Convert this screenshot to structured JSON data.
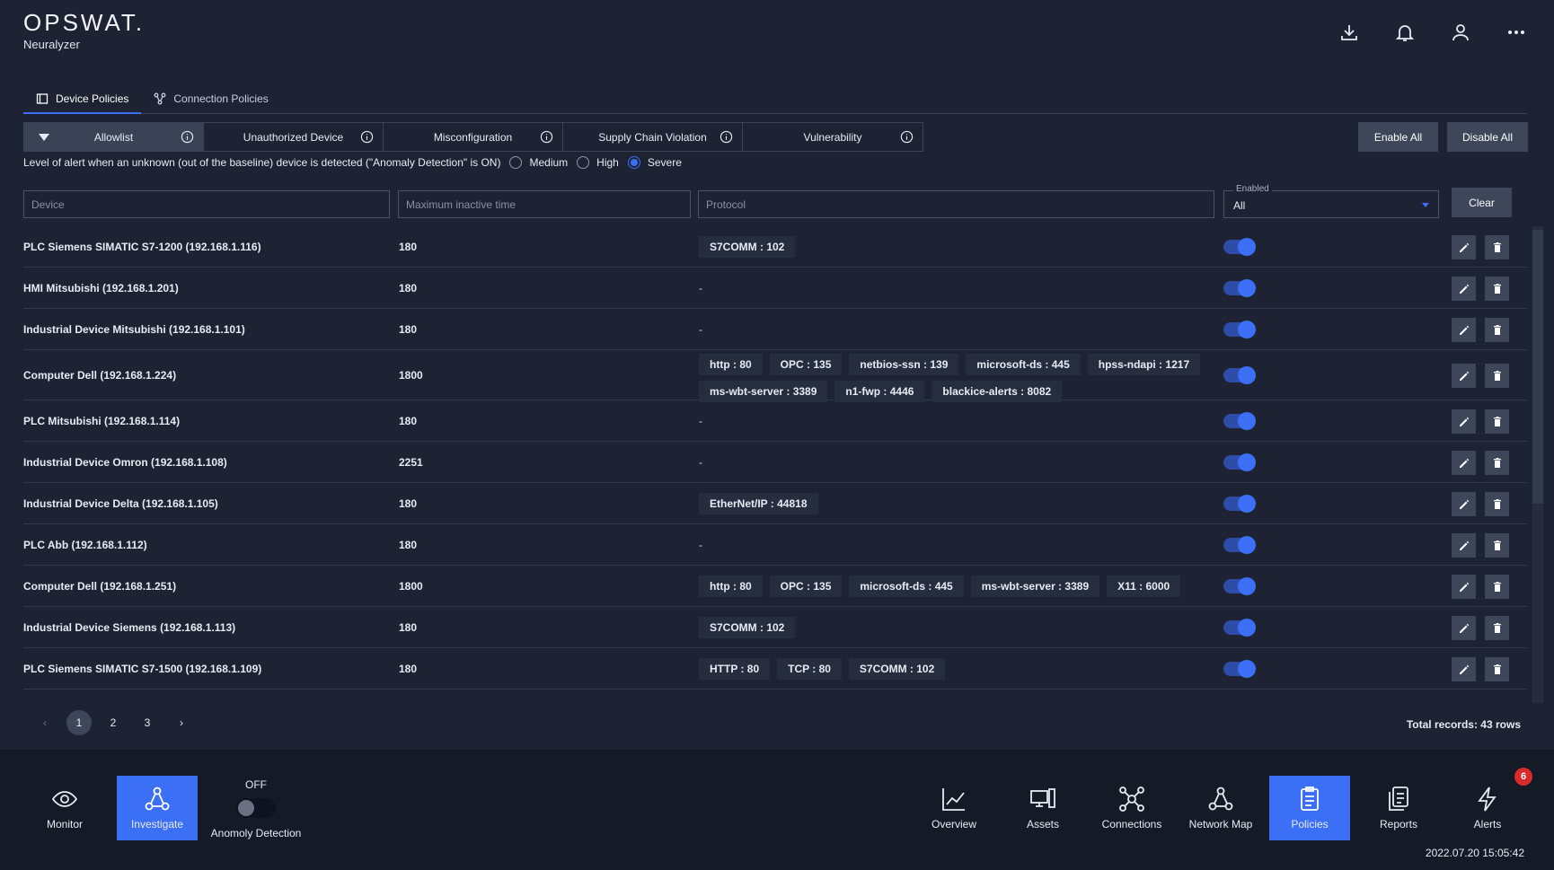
{
  "brand": {
    "logo": "OPSWAT.",
    "product": "Neuralyzer"
  },
  "top_actions": [
    "download-icon",
    "bell-icon",
    "user-icon",
    "more-icon"
  ],
  "tabs": [
    {
      "label": "Device Policies",
      "active": true
    },
    {
      "label": "Connection Policies",
      "active": false
    }
  ],
  "categories": [
    {
      "label": "Allowlist",
      "active": true
    },
    {
      "label": "Unauthorized Device"
    },
    {
      "label": "Misconfiguration"
    },
    {
      "label": "Supply Chain Violation"
    },
    {
      "label": "Vulnerability"
    }
  ],
  "buttons": {
    "enable_all": "Enable All",
    "disable_all": "Disable All",
    "clear": "Clear"
  },
  "alert_level": {
    "text": "Level of alert when an unknown (out of the baseline) device is detected (\"Anomaly Detection\" is ON)",
    "options": [
      "Medium",
      "High",
      "Severe"
    ],
    "selected": "Severe"
  },
  "filters": {
    "device_placeholder": "Device",
    "time_placeholder": "Maximum inactive time",
    "protocol_placeholder": "Protocol",
    "enabled_label": "Enabled",
    "enabled_value": "All"
  },
  "rows": [
    {
      "device": "PLC Siemens SIMATIC S7-1200 (192.168.1.116)",
      "time": "180",
      "protocols": [
        "S7COMM : 102"
      ],
      "enabled": true
    },
    {
      "device": "HMI Mitsubishi (192.168.1.201)",
      "time": "180",
      "protocols": [],
      "enabled": true
    },
    {
      "device": "Industrial Device Mitsubishi (192.168.1.101)",
      "time": "180",
      "protocols": [],
      "enabled": true
    },
    {
      "device": "Computer Dell (192.168.1.224)",
      "time": "1800",
      "protocols": [
        "http : 80",
        "OPC : 135",
        "netbios-ssn : 139",
        "microsoft-ds : 445",
        "hpss-ndapi : 1217",
        "ms-wbt-server : 3389",
        "n1-fwp : 4446",
        "blackice-alerts : 8082"
      ],
      "enabled": true
    },
    {
      "device": "PLC Mitsubishi (192.168.1.114)",
      "time": "180",
      "protocols": [],
      "enabled": true
    },
    {
      "device": "Industrial Device Omron (192.168.1.108)",
      "time": "2251",
      "protocols": [],
      "enabled": true
    },
    {
      "device": "Industrial Device Delta (192.168.1.105)",
      "time": "180",
      "protocols": [
        "EtherNet/IP : 44818"
      ],
      "enabled": true
    },
    {
      "device": "PLC Abb (192.168.1.112)",
      "time": "180",
      "protocols": [],
      "enabled": true
    },
    {
      "device": "Computer Dell (192.168.1.251)",
      "time": "1800",
      "protocols": [
        "http : 80",
        "OPC : 135",
        "microsoft-ds : 445",
        "ms-wbt-server : 3389",
        "X11 : 6000"
      ],
      "enabled": true
    },
    {
      "device": "Industrial Device Siemens (192.168.1.113)",
      "time": "180",
      "protocols": [
        "S7COMM : 102"
      ],
      "enabled": true
    },
    {
      "device": "PLC Siemens SIMATIC S7-1500 (192.168.1.109)",
      "time": "180",
      "protocols": [
        "HTTP : 80",
        "TCP : 80",
        "S7COMM : 102"
      ],
      "enabled": true
    }
  ],
  "empty_protocol": "-",
  "pagination": {
    "pages": [
      "1",
      "2",
      "3"
    ],
    "current": "1",
    "prev": "‹",
    "next": "›"
  },
  "total": "Total records: 43 rows",
  "footer": {
    "left_nav": [
      {
        "label": "Monitor",
        "icon": "eye-icon",
        "active": false
      },
      {
        "label": "Investigate",
        "icon": "investigate-icon",
        "active": true
      }
    ],
    "anomaly": {
      "state": "OFF",
      "label": "Anomoly Detection"
    },
    "right_nav": [
      {
        "label": "Overview",
        "icon": "chart-icon",
        "active": false
      },
      {
        "label": "Assets",
        "icon": "devices-icon",
        "active": false
      },
      {
        "label": "Connections",
        "icon": "connections-icon",
        "active": false
      },
      {
        "label": "Network Map",
        "icon": "network-icon",
        "active": false
      },
      {
        "label": "Policies",
        "icon": "clipboard-icon",
        "active": true
      },
      {
        "label": "Reports",
        "icon": "reports-icon",
        "active": false
      },
      {
        "label": "Alerts",
        "icon": "bolt-icon",
        "active": false
      }
    ],
    "alerts_badge": "6",
    "timestamp": "2022.07.20 15:05:42"
  },
  "colors": {
    "accent": "#3b6ff5",
    "background": "#1d2333",
    "footer": "#151a27",
    "badge": "#d92a2a"
  }
}
